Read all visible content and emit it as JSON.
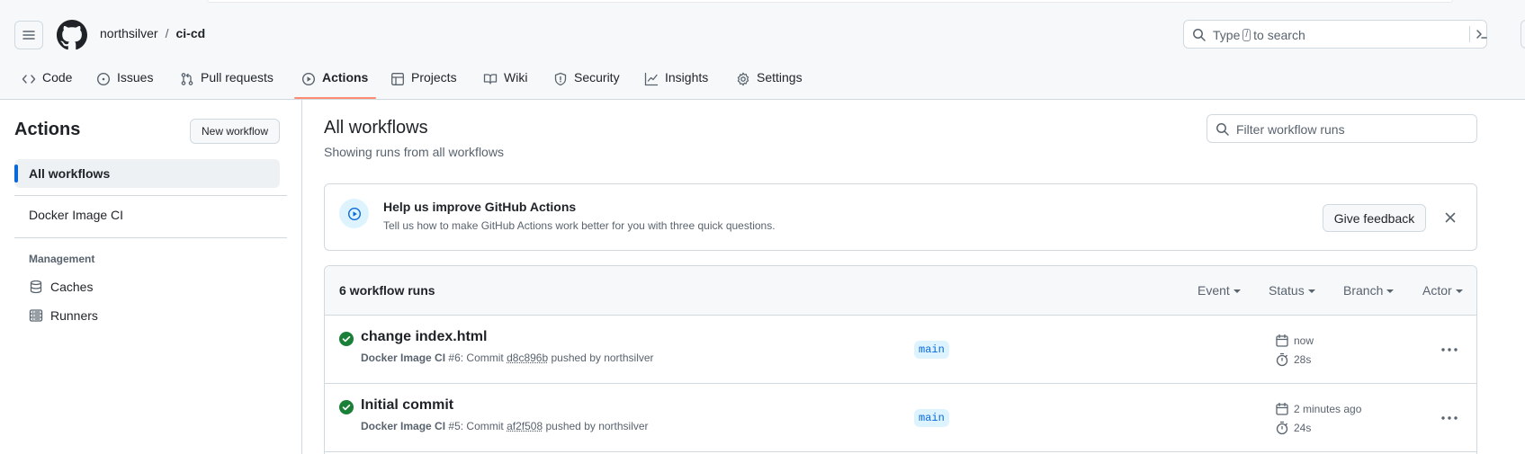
{
  "header": {
    "owner": "northsilver",
    "separator": "/",
    "repo": "ci-cd",
    "search_prefix": "Type",
    "search_key": "/",
    "search_suffix": "to search"
  },
  "nav": {
    "tabs": [
      {
        "label": "Code",
        "icon": "code-icon"
      },
      {
        "label": "Issues",
        "icon": "issue-icon"
      },
      {
        "label": "Pull requests",
        "icon": "pull-request-icon"
      },
      {
        "label": "Actions",
        "icon": "play-icon",
        "active": true
      },
      {
        "label": "Projects",
        "icon": "table-icon"
      },
      {
        "label": "Wiki",
        "icon": "book-icon"
      },
      {
        "label": "Security",
        "icon": "shield-icon"
      },
      {
        "label": "Insights",
        "icon": "graph-icon"
      },
      {
        "label": "Settings",
        "icon": "gear-icon"
      }
    ]
  },
  "sidebar": {
    "title": "Actions",
    "new_workflow": "New workflow",
    "all_workflows": "All workflows",
    "workflows": [
      "Docker Image CI"
    ],
    "management_heading": "Management",
    "management_items": [
      {
        "label": "Caches",
        "icon": "database-icon"
      },
      {
        "label": "Runners",
        "icon": "server-icon"
      }
    ]
  },
  "main": {
    "title": "All workflows",
    "subtitle": "Showing runs from all workflows",
    "filter_placeholder": "Filter workflow runs"
  },
  "feedback": {
    "title": "Help us improve GitHub Actions",
    "description": "Tell us how to make GitHub Actions work better for you with three quick questions.",
    "button": "Give feedback"
  },
  "runs": {
    "count_label": "6 workflow runs",
    "filters": [
      "Event",
      "Status",
      "Branch",
      "Actor"
    ],
    "items": [
      {
        "title": "change index.html",
        "workflow": "Docker Image CI",
        "run_number": "#6",
        "commit_prefix": ": Commit",
        "sha": "d8c896b",
        "pushed_by": "pushed by northsilver",
        "branch": "main",
        "time": "now",
        "duration": "28s",
        "status": "success"
      },
      {
        "title": "Initial commit",
        "workflow": "Docker Image CI",
        "run_number": "#5",
        "commit_prefix": ": Commit",
        "sha": "af2f508",
        "pushed_by": "pushed by northsilver",
        "branch": "main",
        "time": "2 minutes ago",
        "duration": "24s",
        "status": "success"
      }
    ]
  },
  "colors": {
    "accent": "#0969da",
    "success": "#1a7f37",
    "active_underline": "#fd8c73"
  }
}
